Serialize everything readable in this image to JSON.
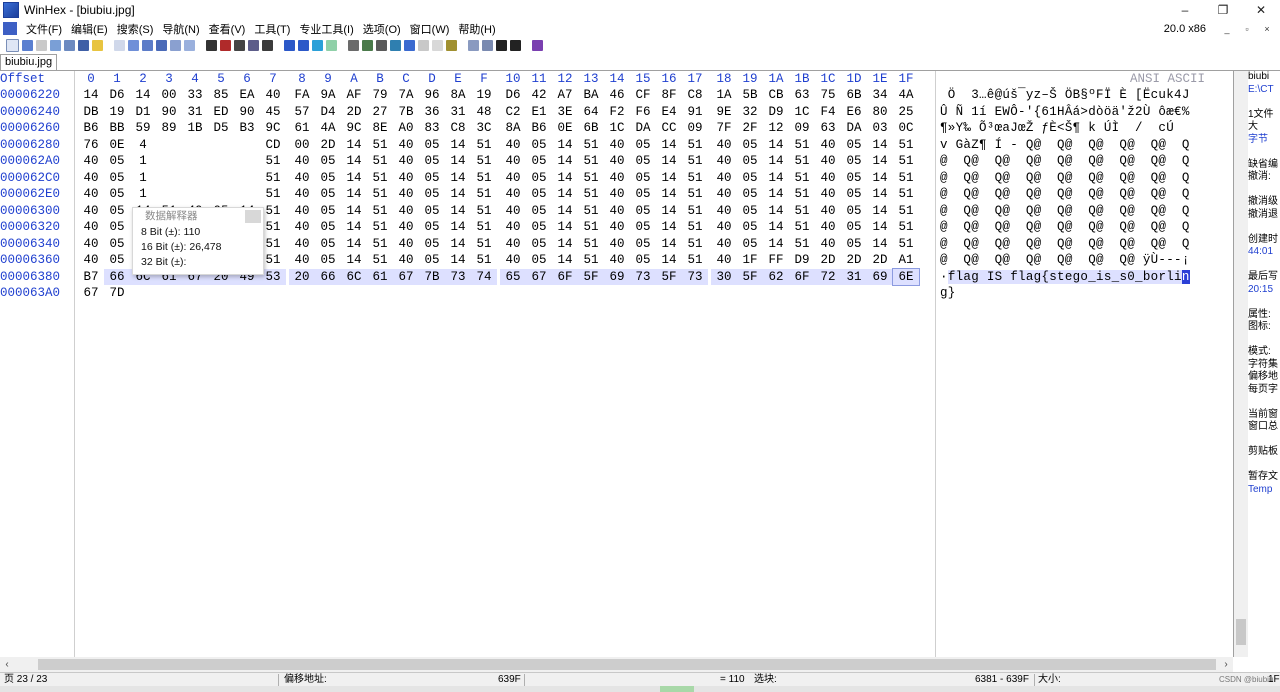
{
  "window": {
    "title": "WinHex - [biubiu.jpg]",
    "minimize": "–",
    "restore": "❐",
    "close": "✕"
  },
  "menu": {
    "items": [
      "文件(F)",
      "编辑(E)",
      "搜索(S)",
      "导航(N)",
      "查看(V)",
      "工具(T)",
      "专业工具(I)",
      "选项(O)",
      "窗口(W)",
      "帮助(H)"
    ],
    "zoom": "20.0 x86",
    "mdi_min": "_",
    "mdi_restore": "▫",
    "mdi_close": "×"
  },
  "tab": {
    "label": "biubiu.jpg"
  },
  "hex": {
    "offset_header": "Offset",
    "columns": [
      "0",
      "1",
      "2",
      "3",
      "4",
      "5",
      "6",
      "7",
      "8",
      "9",
      "A",
      "B",
      "C",
      "D",
      "E",
      "F",
      "10",
      "11",
      "12",
      "13",
      "14",
      "15",
      "16",
      "17",
      "18",
      "19",
      "1A",
      "1B",
      "1C",
      "1D",
      "1E",
      "1F"
    ],
    "ascii_header": "ANSI ASCII",
    "rows": [
      {
        "offset": "00006220",
        "bytes": [
          "14",
          "D6",
          "14",
          "00",
          "33",
          "85",
          "EA",
          "40",
          "FA",
          "9A",
          "AF",
          "79",
          "7A",
          "96",
          "8A",
          "19",
          "D6",
          "42",
          "A7",
          "BA",
          "46",
          "CF",
          "8F",
          "C8",
          "1A",
          "5B",
          "CB",
          "63",
          "75",
          "6B",
          "34",
          "4A"
        ],
        "ascii": " Ö  3…ê@úš¯yz–Š ÖB§ºFÏ È [Ëcuk4J"
      },
      {
        "offset": "00006240",
        "bytes": [
          "DB",
          "19",
          "D1",
          "90",
          "31",
          "ED",
          "90",
          "45",
          "57",
          "D4",
          "2D",
          "27",
          "7B",
          "36",
          "31",
          "48",
          "C2",
          "E1",
          "3E",
          "64",
          "F2",
          "F6",
          "E4",
          "91",
          "9E",
          "32",
          "D9",
          "1C",
          "F4",
          "E6",
          "80",
          "25"
        ],
        "ascii": "Û Ñ 1í EWÔ-'{61HÂá>dòöä'ž2Ù ôæ€%"
      },
      {
        "offset": "00006260",
        "bytes": [
          "B6",
          "BB",
          "59",
          "89",
          "1B",
          "D5",
          "B3",
          "9C",
          "61",
          "4A",
          "9C",
          "8E",
          "A0",
          "83",
          "C8",
          "3C",
          "8A",
          "B6",
          "0E",
          "6B",
          "1C",
          "DA",
          "CC",
          "09",
          "7F",
          "2F",
          "12",
          "09",
          "63",
          "DA",
          "03",
          "0C"
        ],
        "ascii": "¶»Y‰ Õ³œaJœŽ ƒÈ<Š¶ k ÚÌ  /  cÚ  "
      },
      {
        "offset": "00006280",
        "bytes": [
          "76",
          "0E",
          "4",
          "",
          "",
          "",
          "",
          "CD",
          "00",
          "2D",
          "14",
          "51",
          "40",
          "05",
          "14",
          "51",
          "40",
          "05",
          "14",
          "51",
          "40",
          "05",
          "14",
          "51",
          "40",
          "05",
          "14",
          "51",
          "40",
          "05",
          "14",
          "51"
        ],
        "ascii": "v GàZ¶ Í - Q@  Q@  Q@  Q@  Q@  Q"
      },
      {
        "offset": "000062A0",
        "bytes": [
          "40",
          "05",
          "1",
          "",
          "",
          "",
          "",
          "51",
          "40",
          "05",
          "14",
          "51",
          "40",
          "05",
          "14",
          "51",
          "40",
          "05",
          "14",
          "51",
          "40",
          "05",
          "14",
          "51",
          "40",
          "05",
          "14",
          "51",
          "40",
          "05",
          "14",
          "51"
        ],
        "ascii": "@  Q@  Q@  Q@  Q@  Q@  Q@  Q@  Q"
      },
      {
        "offset": "000062C0",
        "bytes": [
          "40",
          "05",
          "1",
          "",
          "",
          "",
          "",
          "51",
          "40",
          "05",
          "14",
          "51",
          "40",
          "05",
          "14",
          "51",
          "40",
          "05",
          "14",
          "51",
          "40",
          "05",
          "14",
          "51",
          "40",
          "05",
          "14",
          "51",
          "40",
          "05",
          "14",
          "51"
        ],
        "ascii": "@  Q@  Q@  Q@  Q@  Q@  Q@  Q@  Q"
      },
      {
        "offset": "000062E0",
        "bytes": [
          "40",
          "05",
          "1",
          "",
          "",
          "",
          "",
          "51",
          "40",
          "05",
          "14",
          "51",
          "40",
          "05",
          "14",
          "51",
          "40",
          "05",
          "14",
          "51",
          "40",
          "05",
          "14",
          "51",
          "40",
          "05",
          "14",
          "51",
          "40",
          "05",
          "14",
          "51"
        ],
        "ascii": "@  Q@  Q@  Q@  Q@  Q@  Q@  Q@  Q"
      },
      {
        "offset": "00006300",
        "bytes": [
          "40",
          "05",
          "14",
          "51",
          "40",
          "05",
          "14",
          "51",
          "40",
          "05",
          "14",
          "51",
          "40",
          "05",
          "14",
          "51",
          "40",
          "05",
          "14",
          "51",
          "40",
          "05",
          "14",
          "51",
          "40",
          "05",
          "14",
          "51",
          "40",
          "05",
          "14",
          "51"
        ],
        "ascii": "@  Q@  Q@  Q@  Q@  Q@  Q@  Q@  Q"
      },
      {
        "offset": "00006320",
        "bytes": [
          "40",
          "05",
          "14",
          "51",
          "40",
          "05",
          "14",
          "51",
          "40",
          "05",
          "14",
          "51",
          "40",
          "05",
          "14",
          "51",
          "40",
          "05",
          "14",
          "51",
          "40",
          "05",
          "14",
          "51",
          "40",
          "05",
          "14",
          "51",
          "40",
          "05",
          "14",
          "51"
        ],
        "ascii": "@  Q@  Q@  Q@  Q@  Q@  Q@  Q@  Q"
      },
      {
        "offset": "00006340",
        "bytes": [
          "40",
          "05",
          "14",
          "51",
          "40",
          "05",
          "14",
          "51",
          "40",
          "05",
          "14",
          "51",
          "40",
          "05",
          "14",
          "51",
          "40",
          "05",
          "14",
          "51",
          "40",
          "05",
          "14",
          "51",
          "40",
          "05",
          "14",
          "51",
          "40",
          "05",
          "14",
          "51"
        ],
        "ascii": "@  Q@  Q@  Q@  Q@  Q@  Q@  Q@  Q"
      },
      {
        "offset": "00006360",
        "bytes": [
          "40",
          "05",
          "14",
          "51",
          "40",
          "05",
          "14",
          "51",
          "40",
          "05",
          "14",
          "51",
          "40",
          "05",
          "14",
          "51",
          "40",
          "05",
          "14",
          "51",
          "40",
          "05",
          "14",
          "51",
          "40",
          "1F",
          "FF",
          "D9",
          "2D",
          "2D",
          "2D",
          "A1"
        ],
        "ascii": "@  Q@  Q@  Q@  Q@  Q@  Q@ ÿÙ---¡"
      },
      {
        "offset": "00006380",
        "bytes": [
          "B7",
          "66",
          "6C",
          "61",
          "67",
          "20",
          "49",
          "53",
          "20",
          "66",
          "6C",
          "61",
          "67",
          "7B",
          "73",
          "74",
          "65",
          "67",
          "6F",
          "5F",
          "69",
          "73",
          "5F",
          "73",
          "30",
          "5F",
          "62",
          "6F",
          "72",
          "31",
          "69",
          "6E"
        ],
        "ascii_pre": "·",
        "ascii_hl": "flag IS flag{stego_is_s0_borli",
        "ascii_cur": "n"
      },
      {
        "offset": "000063A0",
        "bytes": [
          "67",
          "7D"
        ],
        "ascii": "g}"
      }
    ]
  },
  "popup": {
    "title": "数据解释器",
    "row8": "8 Bit (±): 110",
    "row16": "16 Bit (±): 26,478",
    "row32": "32 Bit (±):"
  },
  "info_panel": {
    "lines": [
      "biubi",
      "E:\\CT",
      "",
      "1文件大",
      "字节",
      "",
      "缺省编",
      "撤消:",
      "",
      "撤消级",
      "撤消退",
      "",
      "创建时",
      "44:01",
      "",
      "最后写",
      "20:15",
      "",
      "属性:",
      "图标:",
      "",
      "模式:",
      "字符集",
      "偏移地",
      "每页字",
      "",
      "当前窗",
      "窗口总",
      "",
      "剪贴板",
      "",
      "暂存文",
      "Temp"
    ]
  },
  "status": {
    "page": "页 23 / 23",
    "offset_label": "偏移地址:",
    "offset_value": "639F",
    "value": "= 110",
    "selection_label": "选块:",
    "selection_value": "6381 - 639F",
    "size_label": "大小:",
    "size_value": "1F"
  },
  "watermark": "CSDN @biubiu"
}
